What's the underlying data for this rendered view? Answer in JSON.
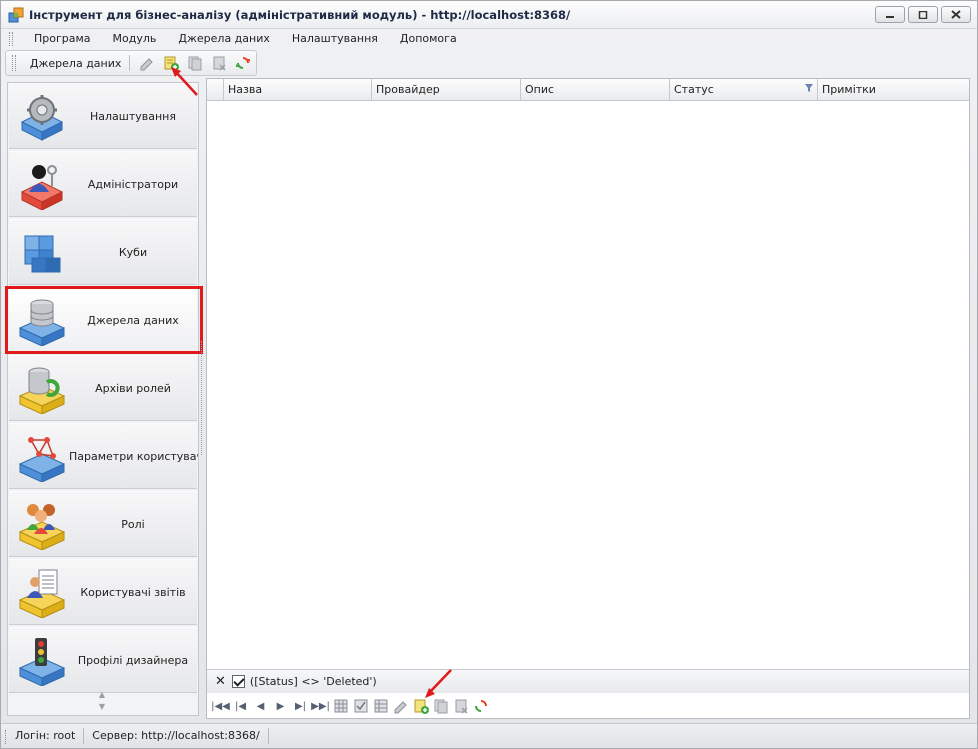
{
  "window": {
    "title": "Інструмент для бізнес-аналізу (адміністративний модуль) - http://localhost:8368/"
  },
  "menu": {
    "items": [
      "Програма",
      "Модуль",
      "Джерела даних",
      "Налаштування",
      "Допомога"
    ]
  },
  "toolbar": {
    "label": "Джерела даних",
    "buttons": [
      "edit-icon",
      "add-datasource-icon",
      "copy-icon",
      "delete-icon",
      "refresh-icon"
    ]
  },
  "nav": {
    "items": [
      {
        "label": "Налаштування",
        "icon": "settings-gear-icon"
      },
      {
        "label": "Адміністратори",
        "icon": "administrator-icon"
      },
      {
        "label": "Куби",
        "icon": "cubes-icon"
      },
      {
        "label": "Джерела даних",
        "icon": "database-icon"
      },
      {
        "label": "Архіви ролей",
        "icon": "role-archive-icon"
      },
      {
        "label": "Параметри користувачів",
        "icon": "user-parameters-icon"
      },
      {
        "label": "Ролі",
        "icon": "roles-icon"
      },
      {
        "label": "Користувачі звітів",
        "icon": "report-users-icon"
      },
      {
        "label": "Профілі дизайнера",
        "icon": "designer-profile-icon"
      }
    ],
    "active_index": 3
  },
  "grid": {
    "columns": [
      "Назва",
      "Провайдер",
      "Опис",
      "Статус",
      "Примітки"
    ],
    "rows": []
  },
  "filter": {
    "enabled": true,
    "expression": "([Status] <> 'Deleted')"
  },
  "statusbar": {
    "login": "Логін: root",
    "server": "Сервер: http://localhost:8368/"
  },
  "colors": {
    "highlight": "#e0191b",
    "accent": "#1f2a44"
  }
}
